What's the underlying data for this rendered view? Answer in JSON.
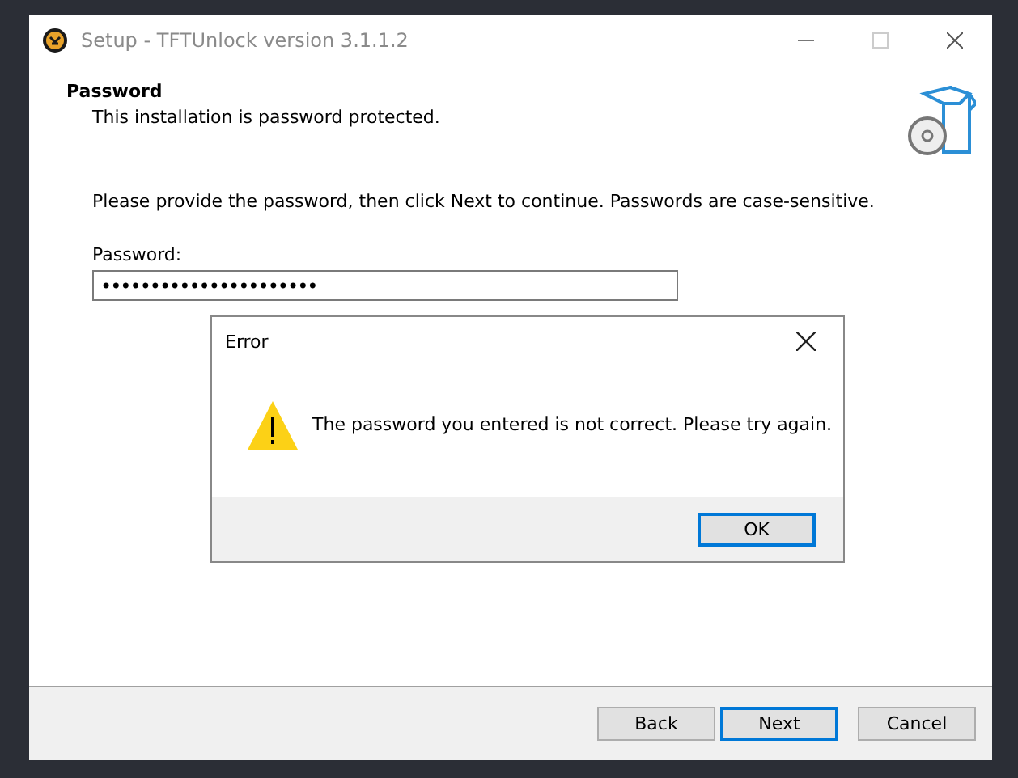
{
  "window": {
    "title": "Setup - TFTUnlock version 3.1.1.2"
  },
  "header": {
    "title": "Password",
    "subtitle": "This installation is password protected."
  },
  "instruction": "Please provide the password, then click Next to continue. Passwords are case-sensitive.",
  "password_field": {
    "label": "Password:",
    "value": "••••••••••••••••••••••"
  },
  "buttons": [
    {
      "label": "Back",
      "default": false
    },
    {
      "label": "Next",
      "default": true
    },
    {
      "label": "Cancel",
      "default": false
    }
  ],
  "error_dialog": {
    "title": "Error",
    "message": "The password you entered is not correct. Please try again.",
    "buttons": [
      {
        "label": "OK",
        "default": true
      }
    ]
  }
}
